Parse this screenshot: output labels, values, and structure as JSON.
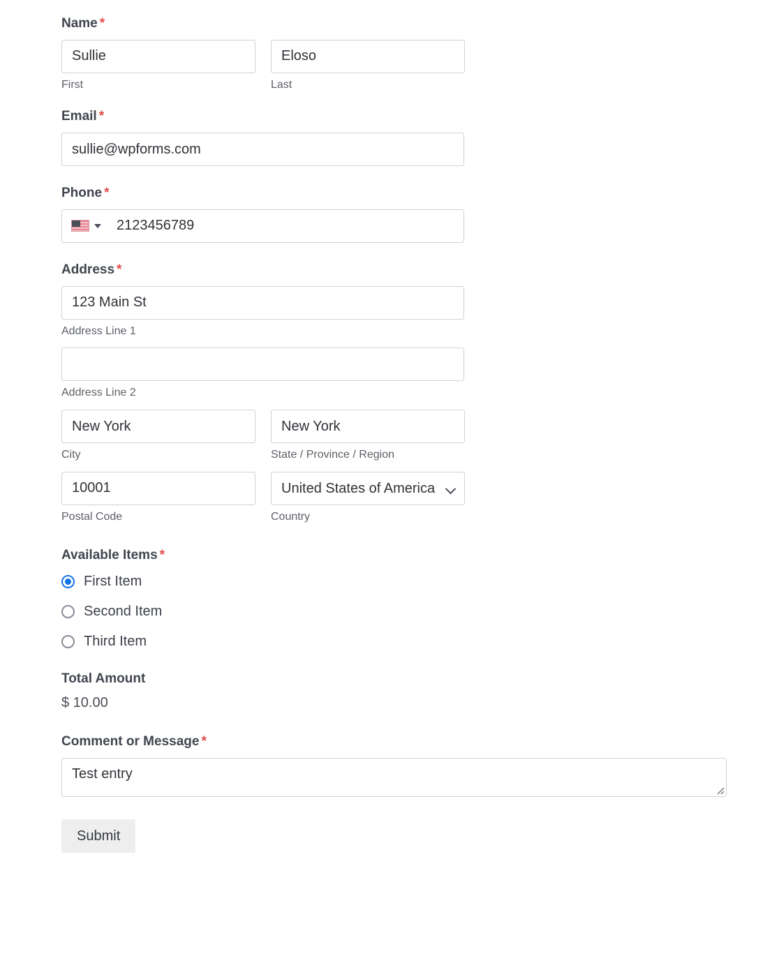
{
  "form": {
    "required_marker": "*",
    "fields": {
      "name": {
        "label": "Name",
        "first": {
          "value": "Sullie",
          "sublabel": "First"
        },
        "last": {
          "value": "Eloso",
          "sublabel": "Last"
        }
      },
      "email": {
        "label": "Email",
        "value": "sullie@wpforms.com"
      },
      "phone": {
        "label": "Phone",
        "value": "2123456789",
        "country_flag": "us-flag-icon"
      },
      "address": {
        "label": "Address",
        "line1": {
          "value": "123 Main St",
          "sublabel": "Address Line 1"
        },
        "line2": {
          "value": "",
          "sublabel": "Address Line 2"
        },
        "city": {
          "value": "New York",
          "sublabel": "City"
        },
        "state": {
          "value": "New York",
          "sublabel": "State / Province / Region"
        },
        "postal": {
          "value": "10001",
          "sublabel": "Postal Code"
        },
        "country": {
          "value": "United States of America",
          "sublabel": "Country"
        }
      },
      "available_items": {
        "label": "Available Items",
        "options": [
          {
            "label": "First Item",
            "selected": true
          },
          {
            "label": "Second Item",
            "selected": false
          },
          {
            "label": "Third Item",
            "selected": false
          }
        ]
      },
      "total_amount": {
        "label": "Total Amount",
        "value": "$ 10.00"
      },
      "comment": {
        "label": "Comment or Message",
        "value": "Test entry"
      }
    },
    "submit": {
      "label": "Submit"
    }
  },
  "colors": {
    "label": "#40454e",
    "required": "#e24b4b",
    "border": "#cfd2d6",
    "radio_selected": "#1273e6",
    "button_bg": "#eeeeee"
  }
}
